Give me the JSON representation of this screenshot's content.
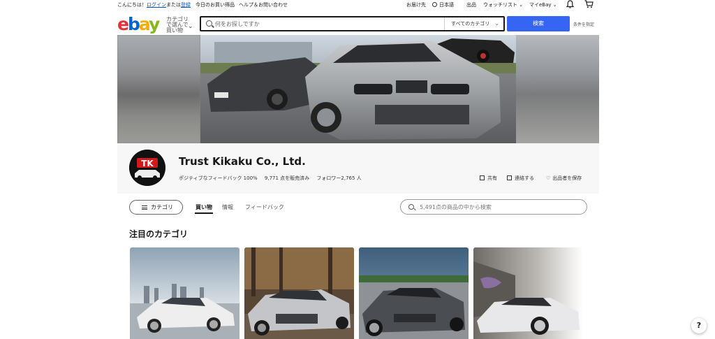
{
  "topbar": {
    "greeting": "こんにちは！",
    "login": "ログイン",
    "or": "または",
    "register": "登録",
    "daily_deals": "今日のお買い得品",
    "help": "ヘルプ＆お問い合わせ",
    "ship_to": "お届け先",
    "language": "日本語",
    "sell": "出品",
    "watchlist": "ウォッチリスト",
    "my_ebay": "マイeBay"
  },
  "header": {
    "logo": {
      "e": "e",
      "b": "b",
      "a": "a",
      "y": "y"
    },
    "category_button": "カテゴリ で選んで 買い物",
    "search_placeholder": "何をお探しですか",
    "category_select": "すべてのカテゴリ",
    "search_button": "検索",
    "advanced": "条件を指定"
  },
  "store": {
    "logo_text": "TK",
    "name": "Trust Kikaku Co., Ltd.",
    "feedback": "ポジティブなフィードバック 100%",
    "sold": "9,771 点を販売済み",
    "followers": "フォロワー2,765 人",
    "share": "共有",
    "contact": "連絡する",
    "save_seller": "出品者を保存"
  },
  "nav": {
    "categories": "カテゴリ",
    "tabs": [
      "買い物",
      "情報",
      "フィードバック"
    ],
    "active_tab": "買い物",
    "store_search_placeholder": "5,491点の商品の中から検索"
  },
  "featured": {
    "title": "注目のカテゴリ"
  },
  "help_label": "?",
  "colors": {
    "brand_red": "#e53238",
    "brand_blue": "#0064d2",
    "brand_yellow": "#f5af02",
    "brand_green": "#86b817",
    "primary_button": "#3665f3",
    "link": "#0654ba"
  }
}
